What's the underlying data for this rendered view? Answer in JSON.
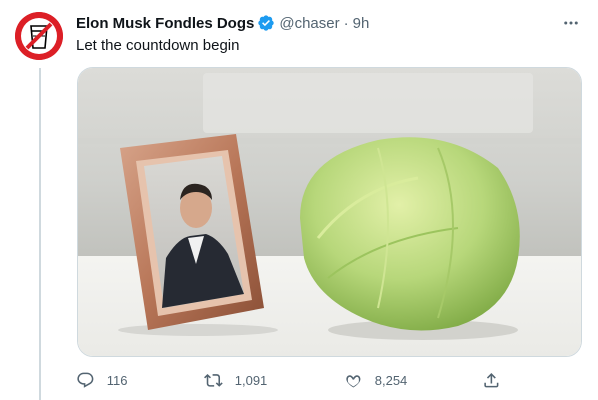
{
  "tweet": {
    "author_name": "Elon Musk Fondles Dogs",
    "handle": "@chaser",
    "separator": "·",
    "time": "9h",
    "text": "Let the countdown begin",
    "verified": true
  },
  "media": {
    "alt": "Framed portrait of a man in a dark suit next to a head of iceberg lettuce on a white table"
  },
  "actions": {
    "reply_count": "116",
    "retweet_count": "1,091",
    "like_count": "8,254"
  },
  "icons": {
    "avatar": "red-cup-logo-icon",
    "verified": "verified-badge-icon",
    "more": "more-icon",
    "reply": "reply-icon",
    "retweet": "retweet-icon",
    "like": "heart-icon",
    "share": "share-icon"
  },
  "colors": {
    "text": "#0f1419",
    "muted": "#536471",
    "verified_blue": "#1d9bf0",
    "avatar_red": "#dc1f26",
    "border": "#cfd9de"
  }
}
